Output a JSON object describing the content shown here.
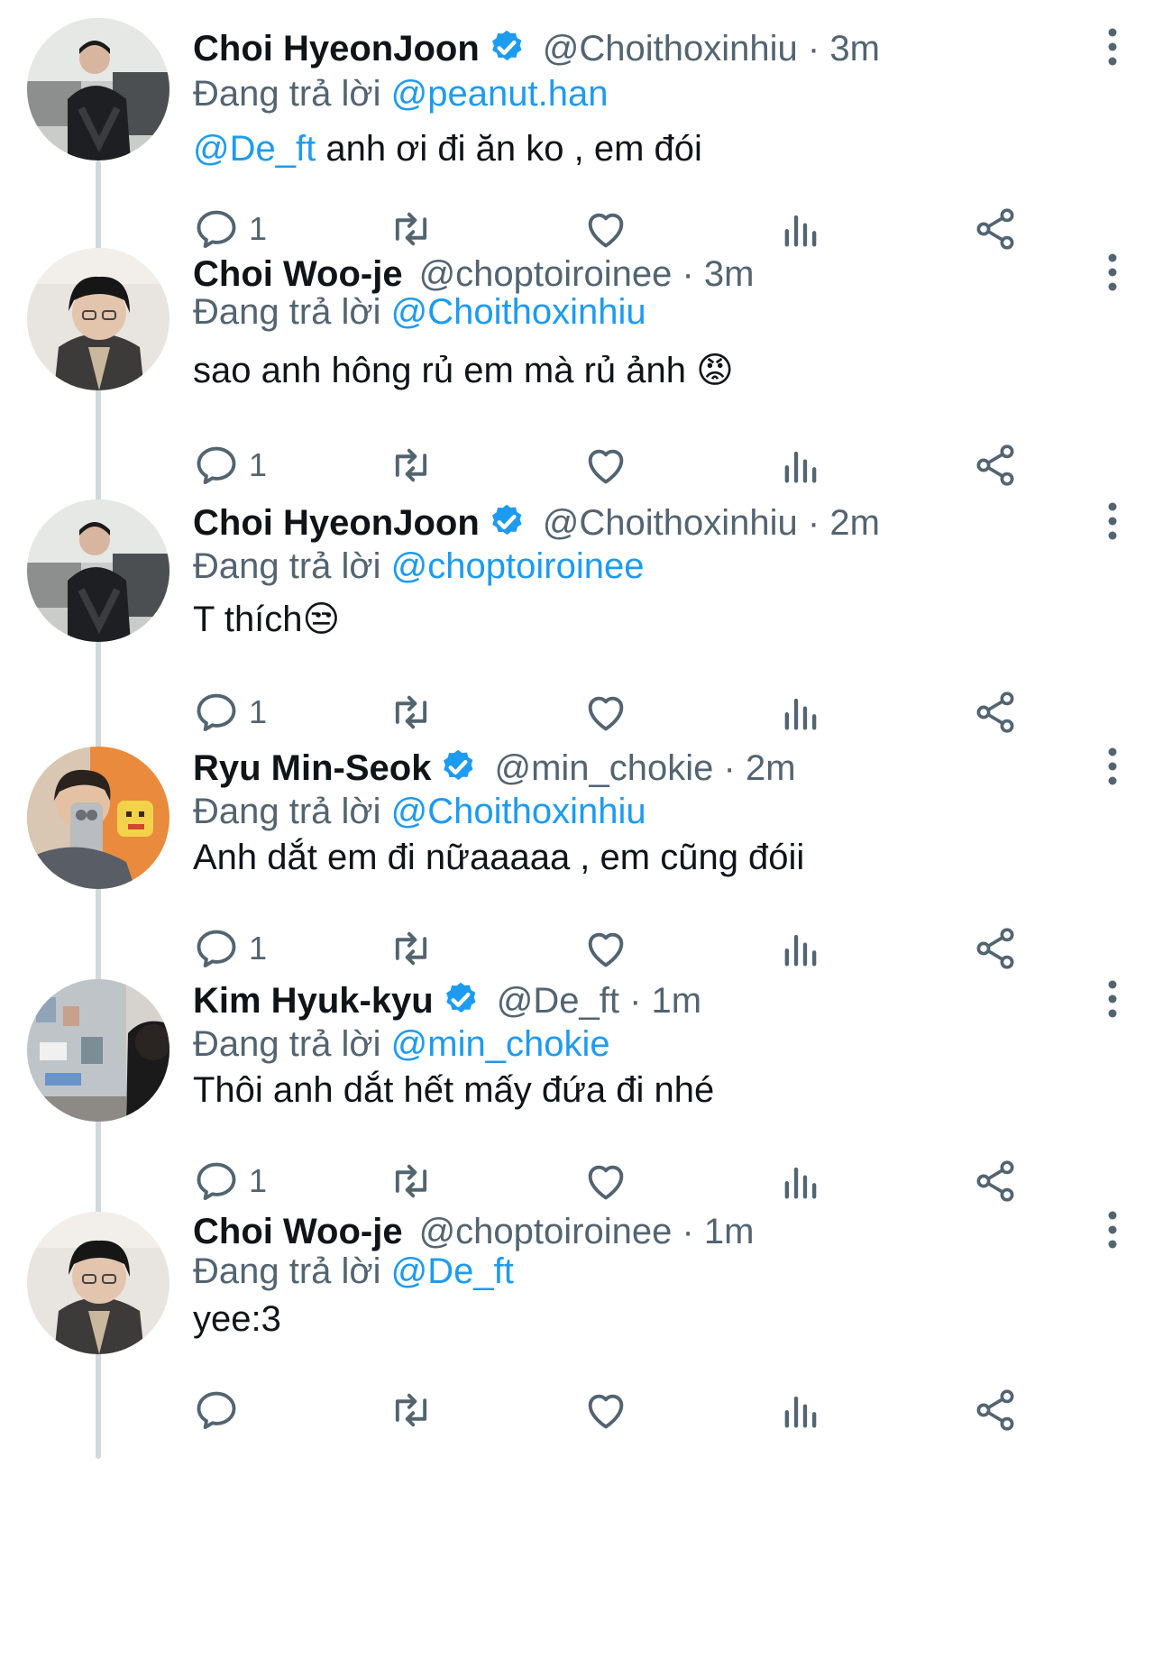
{
  "colors": {
    "link": "#1d9bf0",
    "muted": "#536471",
    "text": "#0f1419",
    "thread_line": "#cfd9de"
  },
  "icons": {
    "reply": "reply-icon",
    "retweet": "retweet-icon",
    "like": "heart-icon",
    "views": "views-icon",
    "share": "share-icon",
    "more": "more-icon",
    "verified": "verified-badge-icon"
  },
  "tweets": [
    {
      "name": "Choi HyeonJoon",
      "verified": true,
      "handle": "@Choithoxinhiu",
      "sep": "·",
      "time": "3m",
      "replying_prefix": "Đang trả lời",
      "replying_to": "@peanut.han",
      "body_mention": "@De_ft",
      "body_text": " anh ơi đi ăn ko , em đói",
      "reply_count": "1"
    },
    {
      "name": "Choi Woo-je",
      "verified": false,
      "handle": "@choptoiroinee",
      "sep": "·",
      "time": "3m",
      "replying_prefix": "Đang trả lời",
      "replying_to": "@Choithoxinhiu",
      "body_mention": "",
      "body_text": "sao anh hông rủ em mà rủ ảnh 😡",
      "reply_count": "1"
    },
    {
      "name": "Choi HyeonJoon",
      "verified": true,
      "handle": "@Choithoxinhiu",
      "sep": "·",
      "time": "2m",
      "replying_prefix": "Đang trả lời",
      "replying_to": "@choptoiroinee",
      "body_mention": "",
      "body_text": "T thích😒",
      "reply_count": "1"
    },
    {
      "name": "Ryu Min-Seok",
      "verified": true,
      "handle": "@min_chokie",
      "sep": "·",
      "time": "2m",
      "replying_prefix": "Đang trả lời",
      "replying_to": "@Choithoxinhiu",
      "body_mention": "",
      "body_text": "Anh dắt em đi nữaaaaa , em cũng đóii",
      "reply_count": "1"
    },
    {
      "name": "Kim Hyuk-kyu",
      "verified": true,
      "handle": "@De_ft",
      "sep": "·",
      "time": "1m",
      "replying_prefix": "Đang trả lời",
      "replying_to": "@min_chokie",
      "body_mention": "",
      "body_text": "Thôi anh dắt hết mấy đứa đi nhé",
      "reply_count": "1"
    },
    {
      "name": "Choi Woo-je",
      "verified": false,
      "handle": "@choptoiroinee",
      "sep": "·",
      "time": "1m",
      "replying_prefix": "Đang trả lời",
      "replying_to": "@De_ft",
      "body_mention": "",
      "body_text": "yee:3",
      "reply_count": ""
    }
  ]
}
